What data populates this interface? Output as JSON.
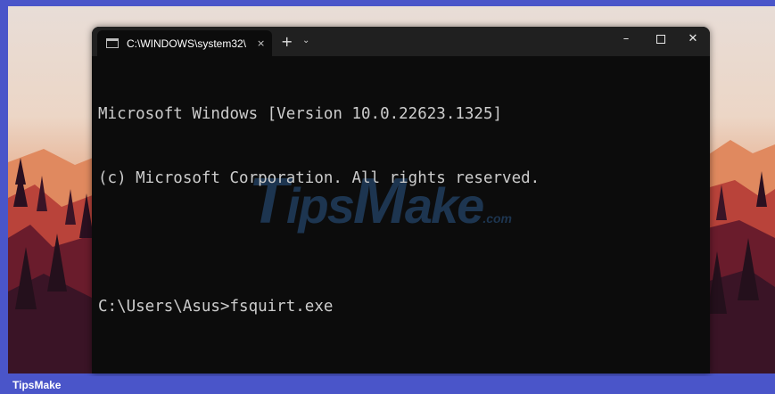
{
  "window": {
    "tab_title": "C:\\WINDOWS\\system32\\",
    "tab_close": "×",
    "new_tab": "+",
    "dropdown": "⌄",
    "minimize": "–",
    "close": "✕"
  },
  "console": {
    "lines": [
      "Microsoft Windows [Version 10.0.22623.1325]",
      "(c) Microsoft Corporation. All rights reserved.",
      "",
      "C:\\Users\\Asus>fsquirt.exe"
    ]
  },
  "watermark": {
    "t": "T",
    "ips": "ips",
    "m": "M",
    "ake": "ake",
    "dotcom": ".com"
  },
  "footer": {
    "label": "TipsMake"
  },
  "colors": {
    "frame_border": "#4a55c9",
    "terminal_bg": "#0c0c0c",
    "titlebar_bg": "#202020",
    "console_text": "#cccccc"
  }
}
